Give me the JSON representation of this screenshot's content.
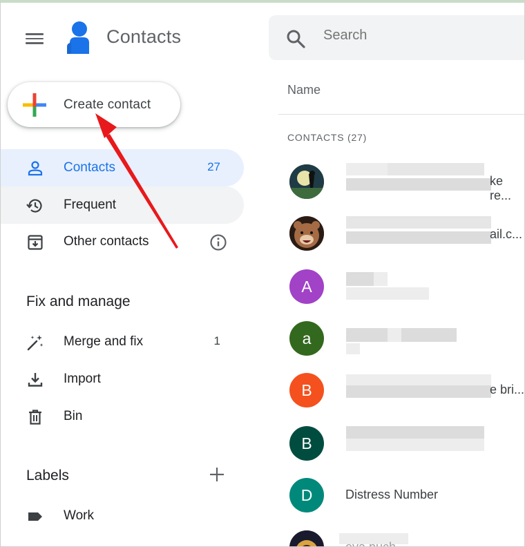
{
  "app": {
    "title": "Contacts"
  },
  "search": {
    "placeholder": "Search"
  },
  "create_button": {
    "label": "Create contact"
  },
  "nav": [
    {
      "label": "Contacts",
      "count": "27",
      "icon": "person-icon",
      "state": "active"
    },
    {
      "label": "Frequent",
      "count": "",
      "icon": "history-icon",
      "state": "hover"
    },
    {
      "label": "Other contacts",
      "count": "",
      "icon": "download-box-icon",
      "state": ""
    }
  ],
  "fix_manage": {
    "title": "Fix and manage",
    "items": [
      {
        "label": "Merge and fix",
        "count": "1",
        "icon": "magic-wand-icon"
      },
      {
        "label": "Import",
        "count": "",
        "icon": "import-icon"
      },
      {
        "label": "Bin",
        "count": "",
        "icon": "trash-icon"
      }
    ]
  },
  "labels": {
    "title": "Labels",
    "items": [
      {
        "label": "Work",
        "icon": "label-icon"
      }
    ]
  },
  "list": {
    "column_header": "Name",
    "section_label": "CONTACTS (27)",
    "rows": [
      {
        "avatar": "photo",
        "letter": "",
        "color": "#2d4a3a",
        "visible_text": "ke re..."
      },
      {
        "avatar": "photo",
        "letter": "",
        "color": "#8b5a3c",
        "visible_text": "ail.c..."
      },
      {
        "avatar": "letter",
        "letter": "A",
        "color": "#a142c7",
        "visible_text": ""
      },
      {
        "avatar": "letter",
        "letter": "a",
        "color": "#33691e",
        "visible_text": ""
      },
      {
        "avatar": "letter",
        "letter": "B",
        "color": "#f4511e",
        "visible_text": "e bri..."
      },
      {
        "avatar": "letter",
        "letter": "B",
        "color": "#004d40",
        "visible_text": ""
      },
      {
        "avatar": "letter",
        "letter": "D",
        "color": "#00897b",
        "visible_text": "Distress Number"
      },
      {
        "avatar": "photo",
        "letter": "",
        "color": "#2b2b2b",
        "visible_text": "eva puch"
      }
    ]
  },
  "colors": {
    "accent_blue": "#1a73e8",
    "active_bg": "#e8f0fe",
    "hover_bg": "#f1f3f4",
    "arrow_red": "#e8191c"
  }
}
